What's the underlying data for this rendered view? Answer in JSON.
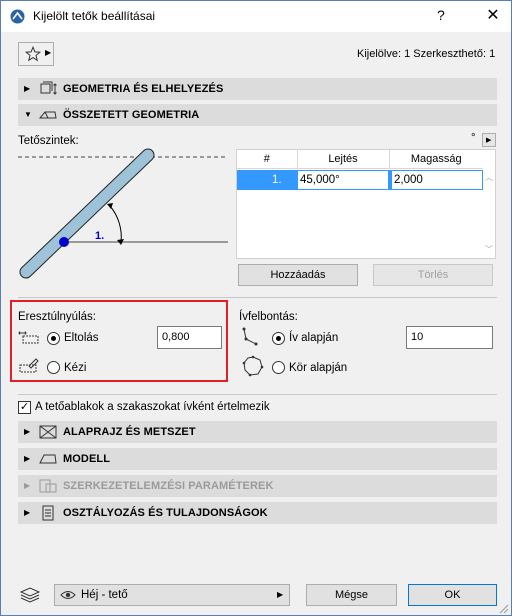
{
  "window": {
    "title": "Kijelölt tetők beállításai",
    "help": "?",
    "close": "✕"
  },
  "toolbar": {
    "favorites_icon": "star-icon",
    "selection_info": "Kijelölve: 1 Szerkeszthető: 1"
  },
  "sections": {
    "geometry": "GEOMETRIA ÉS ELHELYEZÉS",
    "complex": "ÖSSZETETT GEOMETRIA",
    "plan": "ALAPRAJZ ÉS METSZET",
    "model": "MODELL",
    "structural": "SZERKEZETELEMZÉSI PARAMÉTEREK",
    "classification": "OSZTÁLYOZÁS ÉS TULAJDONSÁGOK"
  },
  "roof_levels": {
    "label": "Tetőszintek:",
    "unit_symbol": "°",
    "diagram_label": "1.",
    "columns": [
      "#",
      "Lejtés",
      "Magasság"
    ],
    "rows": [
      {
        "num": "1.",
        "slope": "45,000°",
        "height": "2,000"
      }
    ],
    "add": "Hozzáadás",
    "delete": "Törlés"
  },
  "eave_overhang": {
    "label": "Eresztúlnyúlás:",
    "offset_label": "Eltolás",
    "offset_value": "0,800",
    "manual_label": "Kézi",
    "selected": "offset"
  },
  "arc_segmentation": {
    "label": "Ívfelbontás:",
    "arc_based": "Ív alapján",
    "arc_value": "10",
    "circle_based": "Kör alapján",
    "selected": "arc"
  },
  "skylight_checkbox": {
    "label": "A tetőablakok a szakaszokat ívként értelmezik",
    "checked": true
  },
  "footer": {
    "layer": "Héj - tető",
    "cancel": "Mégse",
    "ok": "OK"
  },
  "colors": {
    "highlight": "#e01f26",
    "selection": "#3399ff",
    "accent": "#0000cc"
  }
}
